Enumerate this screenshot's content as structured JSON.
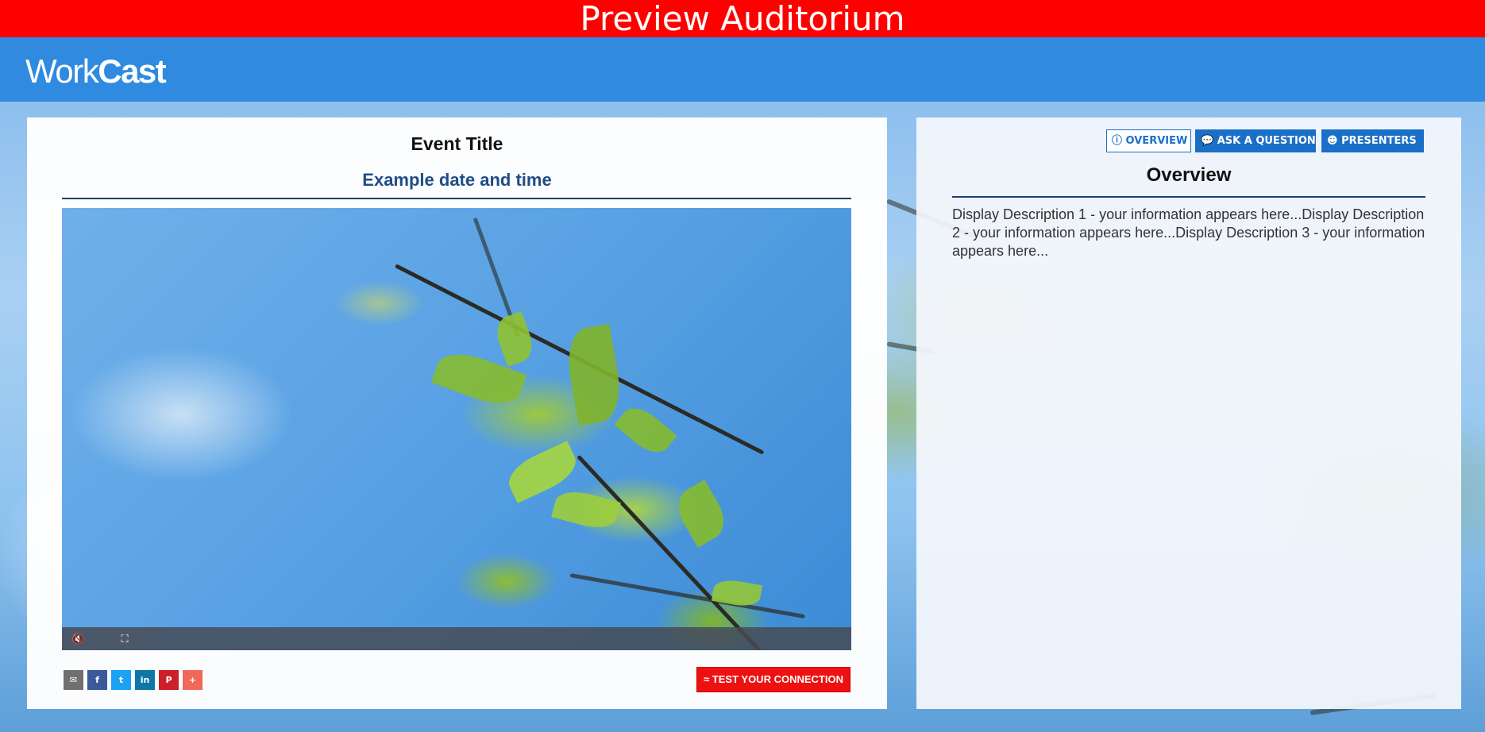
{
  "banner": {
    "title": "Preview Auditorium"
  },
  "brand": {
    "logo_light": "Work",
    "logo_bold": "Cast"
  },
  "event": {
    "title": "Event Title",
    "date": "Example date and time"
  },
  "player": {
    "mute_icon": "muted-speaker-icon",
    "fullscreen_icon": "fullscreen-icon"
  },
  "share": {
    "buttons": [
      {
        "name": "email",
        "glyph": "✉",
        "color": "#707070"
      },
      {
        "name": "facebook",
        "glyph": "f",
        "color": "#3b5998"
      },
      {
        "name": "twitter",
        "glyph": "t",
        "color": "#1da1f2"
      },
      {
        "name": "linkedin",
        "glyph": "in",
        "color": "#0e76a8"
      },
      {
        "name": "pinterest",
        "glyph": "P",
        "color": "#cb2027"
      },
      {
        "name": "more",
        "glyph": "+",
        "color": "#f0685a"
      }
    ]
  },
  "actions": {
    "test_connection": "TEST YOUR CONNECTION"
  },
  "tabs": {
    "overview": "OVERVIEW",
    "ask_question": "ASK A QUESTION",
    "presenters": "PRESENTERS"
  },
  "overview": {
    "heading": "Overview",
    "description": "Display Description 1 - your information appears here...Display Description 2 - your information appears here...Display Description 3 - your information appears here..."
  },
  "colors": {
    "banner": "#ff0000",
    "brand_bar": "#2f8ae0",
    "accent_blue": "#1a6fc9",
    "date_text": "#1e4d86",
    "test_button": "#ee1111"
  }
}
